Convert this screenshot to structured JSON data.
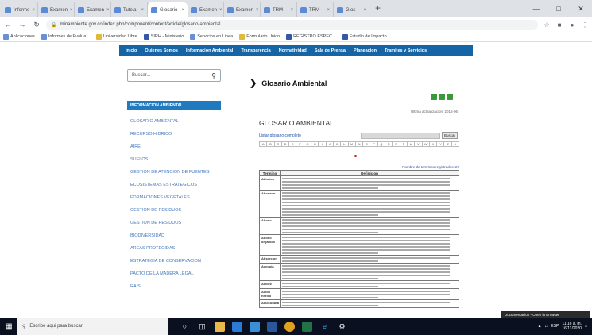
{
  "browser": {
    "tabs": [
      {
        "label": "Informe"
      },
      {
        "label": "Examen"
      },
      {
        "label": "Examen"
      },
      {
        "label": "Tutela"
      },
      {
        "label": "Glosario",
        "active": true
      },
      {
        "label": "Examen"
      },
      {
        "label": "Examen"
      },
      {
        "label": "TRM"
      },
      {
        "label": "TRM"
      },
      {
        "label": "Glos"
      }
    ],
    "url": "minambiente.gov.co/index.php/component/content/article/glosario-ambiental",
    "bookmarks": [
      {
        "label": "Aplicaciones",
        "icon": "apps-icon",
        "color": "#6a8fd9"
      },
      {
        "label": "Informes de Evalua...",
        "icon": "page-icon",
        "color": "#6a8fd9"
      },
      {
        "label": "Universidad Libre",
        "icon": "page-icon",
        "color": "#e2b93b"
      },
      {
        "label": "SIRH - Ministerio",
        "icon": "page-icon",
        "color": "#3557a8"
      },
      {
        "label": "Servicios en Linea",
        "icon": "page-icon",
        "color": "#6a8fd9"
      },
      {
        "label": "Formulario Unico",
        "icon": "page-icon",
        "color": "#e2b93b"
      },
      {
        "label": "REGISTRO ESPEC...",
        "icon": "page-icon",
        "color": "#3557a8"
      },
      {
        "label": "Estudio de Impacto",
        "icon": "page-icon",
        "color": "#3557a8"
      }
    ]
  },
  "site": {
    "nav": [
      "Inicio",
      "Quienes Somos",
      "Informacion Ambiental",
      "Transparencia",
      "Normatividad",
      "Sala de Prensa",
      "Planeacion",
      "Tramites y Servicios"
    ],
    "search_placeholder": "Buscar...",
    "sidebar_heading": "INFORMACION AMBIENTAL",
    "sidebar_items": [
      "GLOSARIO AMBIENTAL",
      "RECURSO HIDRICO",
      "AIRE",
      "SUELOS",
      "GESTION DE ATENCION DE FUENTES",
      "ECOSISTEMAS ESTRATEGICOS",
      "FORMACIONES VEGETALES",
      "GESTION DE RESIDUOS",
      "GESTION DE RESIDUOS",
      "BIODIVERSIDAD",
      "AREAS PROTEGIDAS",
      "ESTRATEGIA DE CONSERVACION",
      "PACTO DE LA MADERA LEGAL",
      "RAIS"
    ]
  },
  "main": {
    "title": "Glosario Ambiental",
    "updated": "Ultima actualizacion: 2016-06",
    "glossary_title": "GLOSARIO AMBIENTAL",
    "full_list_link": "Listar glosario completo",
    "search_button": "Buscar",
    "letters": [
      "A",
      "B",
      "C",
      "D",
      "E",
      "F",
      "G",
      "H",
      "I",
      "J",
      "K",
      "L",
      "M",
      "N",
      "O",
      "P",
      "Q",
      "R",
      "S",
      "T",
      "U",
      "V",
      "W",
      "X",
      "Y",
      "Z",
      "#"
    ],
    "terms_link": "Nombre de terminos registrados: 27",
    "table_headers": [
      "Termino",
      "Definicion"
    ],
    "rows": [
      {
        "term": "Abiotico",
        "lines": 4
      },
      {
        "term": "Abonado",
        "lines": 8
      },
      {
        "term": "Abono",
        "lines": 5
      },
      {
        "term": "Abono organico",
        "lines": 6
      },
      {
        "term": "Absorcion",
        "lines": 2
      },
      {
        "term": "Acequia",
        "lines": 5
      },
      {
        "term": "Acidez",
        "lines": 2
      },
      {
        "term": "Acido nitrico",
        "lines": 3
      },
      {
        "term": "Acuicultura",
        "lines": 2
      }
    ]
  },
  "notification": "Documentacion - Open in Browser",
  "taskbar": {
    "search_placeholder": "Escribe aqui para buscar",
    "time": "11:16 a. m.",
    "date": "16/11/2020",
    "lang": "ESP"
  }
}
